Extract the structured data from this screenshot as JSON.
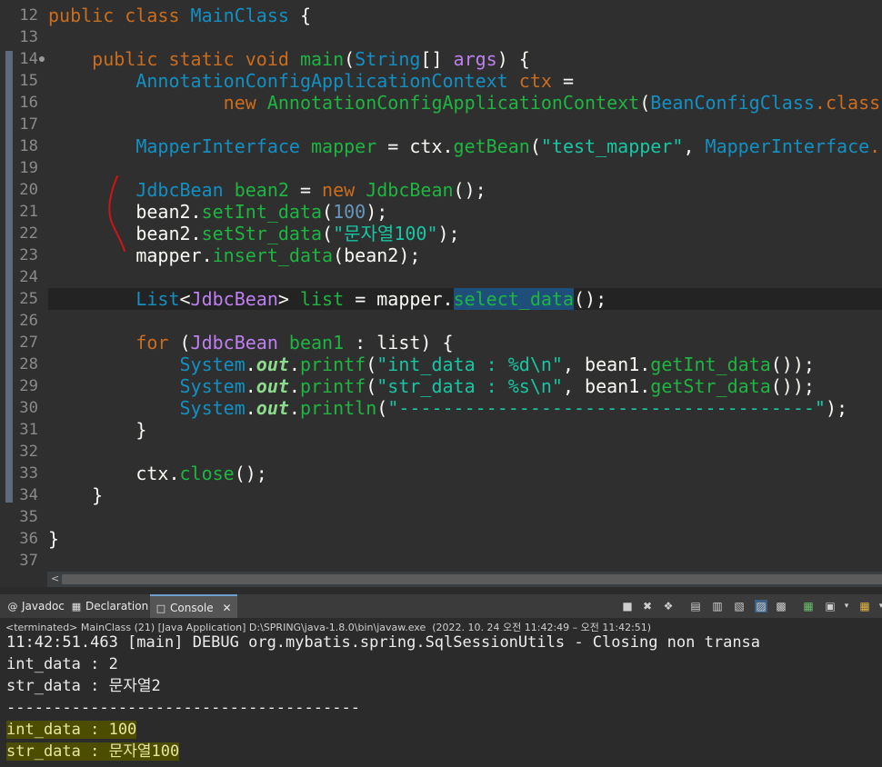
{
  "editor": {
    "lines": [
      {
        "num": "12",
        "segments": [
          {
            "t": "public class ",
            "c": "kw"
          },
          {
            "t": "MainClass",
            "c": "cls"
          },
          {
            "t": " {",
            "c": "plain"
          }
        ]
      },
      {
        "num": "13",
        "segments": []
      },
      {
        "num": "14",
        "fold": true,
        "segments": [
          {
            "t": "    public static void ",
            "c": "kw"
          },
          {
            "t": "main",
            "c": "fn"
          },
          {
            "t": "(",
            "c": "plain"
          },
          {
            "t": "String",
            "c": "cls"
          },
          {
            "t": "[] ",
            "c": "plain"
          },
          {
            "t": "args",
            "c": "tp"
          },
          {
            "t": ") {",
            "c": "plain"
          }
        ]
      },
      {
        "num": "15",
        "segments": [
          {
            "t": "        ",
            "c": "plain"
          },
          {
            "t": "AnnotationConfigApplicationContext",
            "c": "cls"
          },
          {
            "t": " ctx ",
            "c": "kw"
          },
          {
            "t": "=",
            "c": "plain"
          }
        ]
      },
      {
        "num": "16",
        "segments": [
          {
            "t": "                ",
            "c": "plain"
          },
          {
            "t": "new ",
            "c": "kw"
          },
          {
            "t": "AnnotationConfigApplicationContext",
            "c": "fn"
          },
          {
            "t": "(",
            "c": "plain"
          },
          {
            "t": "BeanConfigClass",
            "c": "cls"
          },
          {
            "t": ".class",
            "c": "kw"
          },
          {
            "t": ");",
            "c": "plain"
          }
        ]
      },
      {
        "num": "17",
        "segments": []
      },
      {
        "num": "18",
        "segments": [
          {
            "t": "        ",
            "c": "plain"
          },
          {
            "t": "MapperInterface",
            "c": "cls"
          },
          {
            "t": " mapper ",
            "c": "fn"
          },
          {
            "t": "= ",
            "c": "plain"
          },
          {
            "t": "ctx",
            "c": "plain"
          },
          {
            "t": ".",
            "c": "plain"
          },
          {
            "t": "getBean",
            "c": "fn"
          },
          {
            "t": "(",
            "c": "plain"
          },
          {
            "t": "\"test_mapper\"",
            "c": "str"
          },
          {
            "t": ", ",
            "c": "plain"
          },
          {
            "t": "MapperInterface",
            "c": "cls"
          },
          {
            "t": ".class);",
            "c": "kw"
          }
        ]
      },
      {
        "num": "19",
        "segments": []
      },
      {
        "num": "20",
        "segments": [
          {
            "t": "        ",
            "c": "plain"
          },
          {
            "t": "JdbcBean",
            "c": "cls"
          },
          {
            "t": " bean2 ",
            "c": "fn"
          },
          {
            "t": "= ",
            "c": "plain"
          },
          {
            "t": "new ",
            "c": "kw"
          },
          {
            "t": "JdbcBean",
            "c": "fn"
          },
          {
            "t": "();",
            "c": "plain"
          }
        ]
      },
      {
        "num": "21",
        "segments": [
          {
            "t": "        bean2.",
            "c": "plain"
          },
          {
            "t": "setInt_data",
            "c": "fn"
          },
          {
            "t": "(",
            "c": "plain"
          },
          {
            "t": "100",
            "c": "num"
          },
          {
            "t": ");",
            "c": "plain"
          }
        ]
      },
      {
        "num": "22",
        "segments": [
          {
            "t": "        bean2.",
            "c": "plain"
          },
          {
            "t": "setStr_data",
            "c": "fn"
          },
          {
            "t": "(",
            "c": "plain"
          },
          {
            "t": "\"문자열100\"",
            "c": "str"
          },
          {
            "t": ");",
            "c": "plain"
          }
        ]
      },
      {
        "num": "23",
        "segments": [
          {
            "t": "        mapper.",
            "c": "plain"
          },
          {
            "t": "insert_data",
            "c": "fn"
          },
          {
            "t": "(bean2);",
            "c": "plain"
          }
        ]
      },
      {
        "num": "24",
        "segments": []
      },
      {
        "num": "25",
        "current": true,
        "segments": [
          {
            "t": "        ",
            "c": "plain"
          },
          {
            "t": "List",
            "c": "cls"
          },
          {
            "t": "<",
            "c": "plain"
          },
          {
            "t": "JdbcBean",
            "c": "tp"
          },
          {
            "t": "> ",
            "c": "plain"
          },
          {
            "t": "list ",
            "c": "fn"
          },
          {
            "t": "= mapper.",
            "c": "plain"
          },
          {
            "t": "select_data",
            "c": "fn selected"
          },
          {
            "t": "();",
            "c": "plain"
          }
        ]
      },
      {
        "num": "26",
        "segments": []
      },
      {
        "num": "27",
        "segments": [
          {
            "t": "        ",
            "c": "plain"
          },
          {
            "t": "for ",
            "c": "kw"
          },
          {
            "t": "(",
            "c": "plain"
          },
          {
            "t": "JdbcBean",
            "c": "tp"
          },
          {
            "t": " bean1 ",
            "c": "fn"
          },
          {
            "t": ": list) {",
            "c": "plain"
          }
        ]
      },
      {
        "num": "28",
        "segments": [
          {
            "t": "            ",
            "c": "plain"
          },
          {
            "t": "System",
            "c": "cls"
          },
          {
            "t": ".",
            "c": "plain"
          },
          {
            "t": "out",
            "c": "st"
          },
          {
            "t": ".",
            "c": "plain"
          },
          {
            "t": "printf",
            "c": "fn"
          },
          {
            "t": "(",
            "c": "plain"
          },
          {
            "t": "\"int_data : %d\\n\"",
            "c": "str"
          },
          {
            "t": ", bean1.",
            "c": "plain"
          },
          {
            "t": "getInt_data",
            "c": "fn"
          },
          {
            "t": "());",
            "c": "plain"
          }
        ]
      },
      {
        "num": "29",
        "segments": [
          {
            "t": "            ",
            "c": "plain"
          },
          {
            "t": "System",
            "c": "cls"
          },
          {
            "t": ".",
            "c": "plain"
          },
          {
            "t": "out",
            "c": "st"
          },
          {
            "t": ".",
            "c": "plain"
          },
          {
            "t": "printf",
            "c": "fn"
          },
          {
            "t": "(",
            "c": "plain"
          },
          {
            "t": "\"str_data : %s\\n\"",
            "c": "str"
          },
          {
            "t": ", bean1.",
            "c": "plain"
          },
          {
            "t": "getStr_data",
            "c": "fn"
          },
          {
            "t": "());",
            "c": "plain"
          }
        ]
      },
      {
        "num": "30",
        "segments": [
          {
            "t": "            ",
            "c": "plain"
          },
          {
            "t": "System",
            "c": "cls"
          },
          {
            "t": ".",
            "c": "plain"
          },
          {
            "t": "out",
            "c": "st"
          },
          {
            "t": ".",
            "c": "plain"
          },
          {
            "t": "println",
            "c": "fn"
          },
          {
            "t": "(",
            "c": "plain"
          },
          {
            "t": "\"--------------------------------------\"",
            "c": "str"
          },
          {
            "t": ");",
            "c": "plain"
          }
        ]
      },
      {
        "num": "31",
        "segments": [
          {
            "t": "        }",
            "c": "plain"
          }
        ]
      },
      {
        "num": "32",
        "segments": []
      },
      {
        "num": "33",
        "segments": [
          {
            "t": "        ctx.",
            "c": "plain"
          },
          {
            "t": "close",
            "c": "fn"
          },
          {
            "t": "();",
            "c": "plain"
          }
        ]
      },
      {
        "num": "34",
        "segments": [
          {
            "t": "    }",
            "c": "plain"
          }
        ]
      },
      {
        "num": "35",
        "segments": []
      },
      {
        "num": "36",
        "segments": [
          {
            "t": "}",
            "c": "plain"
          }
        ]
      },
      {
        "num": "37",
        "segments": []
      }
    ]
  },
  "panel": {
    "tabs": {
      "javadoc": "Javadoc",
      "declaration": "Declaration",
      "console": "Console"
    },
    "status": "<terminated> MainClass (21) [Java Application] D:\\SPRING\\java-1.8.0\\bin\\javaw.exe  (2022. 10. 24 오전 11:42:49 – 오전 11:42:51)",
    "output": [
      {
        "text": "11:42:51.463 [main] DEBUG org.mybatis.spring.SqlSessionUtils - Closing non transa",
        "hl": false
      },
      {
        "text": "int_data : 2",
        "hl": false
      },
      {
        "text": "str_data : 문자열2",
        "hl": false
      },
      {
        "text": "--------------------------------------",
        "hl": false
      },
      {
        "text": "int_data : 100",
        "hl": true
      },
      {
        "text": "str_data : 문자열100",
        "hl": true
      }
    ]
  },
  "colors": {
    "annotation_pen": "#d21414",
    "highlight": "#4d4d00"
  }
}
